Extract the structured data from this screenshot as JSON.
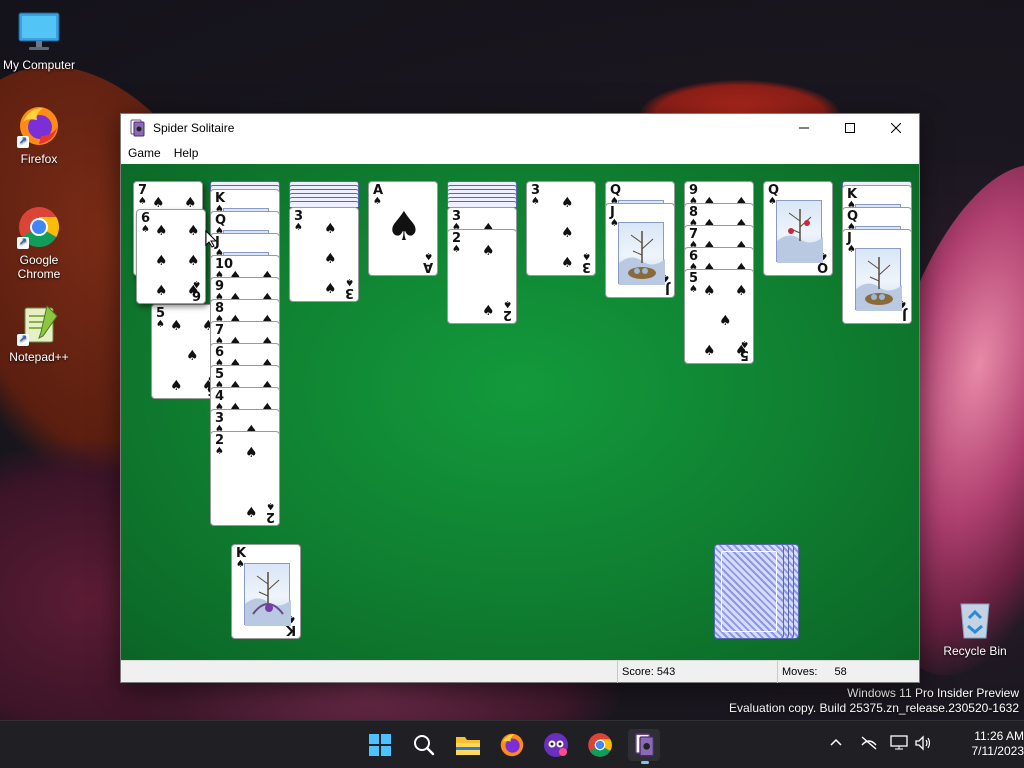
{
  "desktop": {
    "icons": [
      {
        "label": "My Computer",
        "name": "my-computer"
      },
      {
        "label": "Firefox",
        "name": "firefox"
      },
      {
        "label": "Google Chrome",
        "name": "google-chrome"
      },
      {
        "label": "Notepad++",
        "name": "notepad-plus-plus"
      },
      {
        "label": "Recycle Bin",
        "name": "recycle-bin"
      }
    ],
    "watermark": {
      "line1": "Windows 11 Pro Insider Preview",
      "line2": "Evaluation copy. Build 25375.zn_release.230520-1632"
    }
  },
  "window": {
    "title": "Spider Solitaire",
    "icon": "spider-solitaire-icon",
    "controls": [
      "minimize",
      "maximize",
      "close"
    ],
    "menu": [
      "Game",
      "Help"
    ],
    "status": {
      "score_label": "Score: 543",
      "moves_label": "Moves:",
      "moves_value": "58"
    }
  },
  "game": {
    "suit": "spades",
    "felt_color": "#0f7e30",
    "columns": [
      {
        "visible": [
          "7",
          "6",
          "5"
        ],
        "note": "dragged cards 7,6 held over column"
      },
      {
        "visible": [
          "K",
          "Q",
          "J",
          "10",
          "9",
          "8",
          "7",
          "6",
          "5",
          "4",
          "3",
          "2"
        ]
      },
      {
        "visible": [
          "3"
        ]
      },
      {
        "visible": [
          "A"
        ]
      },
      {
        "visible": [
          "3",
          "2"
        ]
      },
      {
        "visible": [
          "3"
        ]
      },
      {
        "visible": [
          "Q",
          "J"
        ]
      },
      {
        "visible": [
          "9",
          "8",
          "7",
          "6",
          "5"
        ]
      },
      {
        "visible": [
          "Q"
        ]
      },
      {
        "visible": [
          "K",
          "Q",
          "J"
        ]
      }
    ],
    "completed_pile_top": "K",
    "stock_piles": 4
  },
  "taskbar": {
    "apps": [
      "start-icon",
      "search-icon",
      "file-explorer-icon",
      "firefox-icon",
      "media-app-icon",
      "chrome-icon",
      "spider-solitaire-icon"
    ],
    "clock": {
      "time": "11:26 AM",
      "date": "7/11/2023"
    }
  }
}
